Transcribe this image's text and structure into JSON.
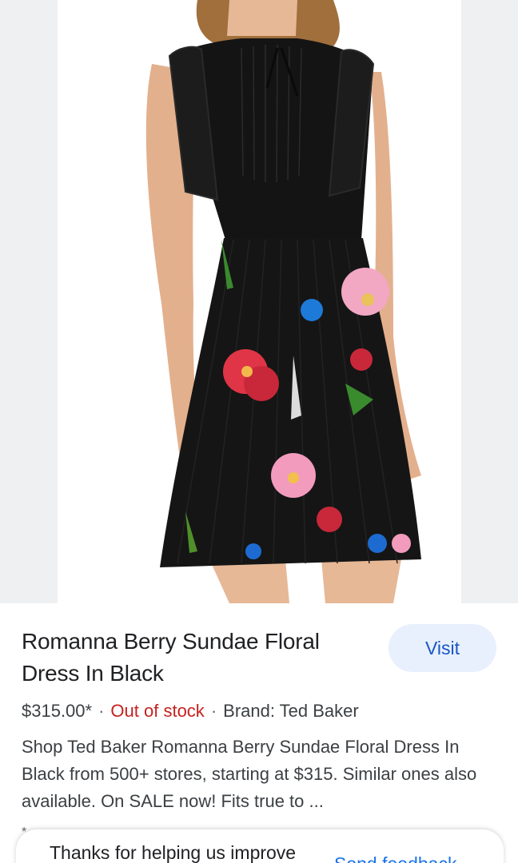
{
  "product": {
    "title": "Romanna Berry Sundae Floral Dress In Black",
    "price": "$315.00*",
    "stock_status": "Out of stock",
    "brand": "Brand: Ted Baker",
    "description": "Shop Ted Baker Romanna Berry Sundae Floral Dress In Black from 500+ stores, starting at $315. Similar ones also available. On SALE now! Fits true to ...",
    "footnote": "* "
  },
  "actions": {
    "visit_label": "Visit"
  },
  "feedback": {
    "prompt": "Thanks for helping us improve",
    "link_label": "Send feedback"
  },
  "colors": {
    "accent": "#1a56c4",
    "visit_bg": "#e8f0fe",
    "out_of_stock": "#c5221f",
    "text": "#202124",
    "subtext": "#3c4043"
  }
}
